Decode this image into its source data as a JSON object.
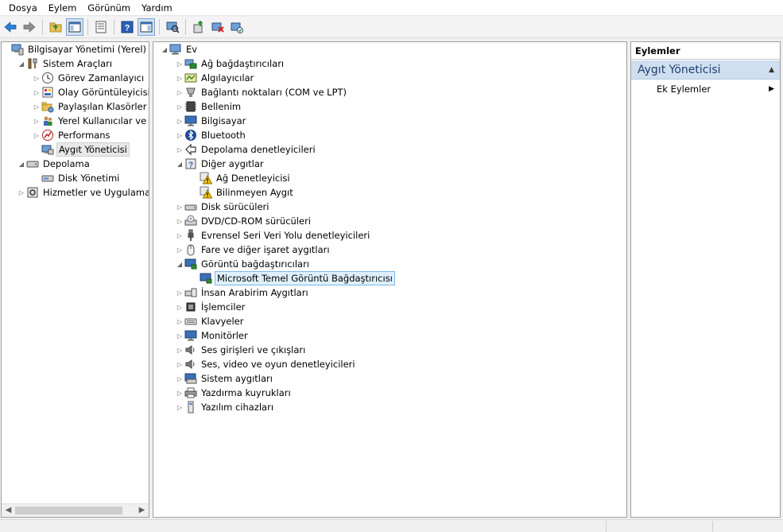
{
  "menu": [
    "Dosya",
    "Eylem",
    "Görünüm",
    "Yardım"
  ],
  "left_tree": [
    {
      "label": "Bilgisayar Yönetimi (Yerel)",
      "level": 0,
      "expander": "",
      "icon": "computer-management-icon"
    },
    {
      "label": "Sistem Araçları",
      "level": 1,
      "expander": "open",
      "icon": "tools-icon"
    },
    {
      "label": "Görev Zamanlayıcı",
      "level": 2,
      "expander": "closed",
      "icon": "clock-icon"
    },
    {
      "label": "Olay Görüntüleyicisi",
      "level": 2,
      "expander": "closed",
      "icon": "event-viewer-icon"
    },
    {
      "label": "Paylaşılan Klasörler",
      "level": 2,
      "expander": "closed",
      "icon": "shared-folder-icon"
    },
    {
      "label": "Yerel Kullanıcılar ve Gru",
      "level": 2,
      "expander": "closed",
      "icon": "users-icon"
    },
    {
      "label": "Performans",
      "level": 2,
      "expander": "closed",
      "icon": "performance-icon"
    },
    {
      "label": "Aygıt Yöneticisi",
      "level": 2,
      "expander": "",
      "icon": "device-manager-icon",
      "selected": true
    },
    {
      "label": "Depolama",
      "level": 1,
      "expander": "open",
      "icon": "storage-icon"
    },
    {
      "label": "Disk Yönetimi",
      "level": 2,
      "expander": "",
      "icon": "disk-management-icon"
    },
    {
      "label": "Hizmetler ve Uygulamalar",
      "level": 1,
      "expander": "closed",
      "icon": "services-icon"
    }
  ],
  "device_tree": [
    {
      "label": "Ev",
      "level": 0,
      "expander": "open",
      "icon": "computer-icon"
    },
    {
      "label": "Ağ bağdaştırıcıları",
      "level": 1,
      "expander": "closed",
      "icon": "network-adapter-icon"
    },
    {
      "label": "Algılayıcılar",
      "level": 1,
      "expander": "closed",
      "icon": "sensor-icon"
    },
    {
      "label": "Bağlantı noktaları (COM ve LPT)",
      "level": 1,
      "expander": "closed",
      "icon": "port-icon"
    },
    {
      "label": "Bellenim",
      "level": 1,
      "expander": "closed",
      "icon": "firmware-icon"
    },
    {
      "label": "Bilgisayar",
      "level": 1,
      "expander": "closed",
      "icon": "monitor-icon"
    },
    {
      "label": "Bluetooth",
      "level": 1,
      "expander": "closed",
      "icon": "bluetooth-icon"
    },
    {
      "label": "Depolama denetleyicileri",
      "level": 1,
      "expander": "closed",
      "icon": "storage-controller-icon"
    },
    {
      "label": "Diğer aygıtlar",
      "level": 1,
      "expander": "open",
      "icon": "other-devices-icon"
    },
    {
      "label": "Ağ Denetleyicisi",
      "level": 2,
      "expander": "",
      "icon": "warning-device-icon"
    },
    {
      "label": "Bilinmeyen Aygıt",
      "level": 2,
      "expander": "",
      "icon": "warning-device-icon"
    },
    {
      "label": "Disk sürücüleri",
      "level": 1,
      "expander": "closed",
      "icon": "disk-drive-icon"
    },
    {
      "label": "DVD/CD-ROM sürücüleri",
      "level": 1,
      "expander": "closed",
      "icon": "dvd-icon"
    },
    {
      "label": "Evrensel Seri Veri Yolu denetleyicileri",
      "level": 1,
      "expander": "closed",
      "icon": "usb-icon"
    },
    {
      "label": "Fare ve diğer işaret aygıtları",
      "level": 1,
      "expander": "closed",
      "icon": "mouse-icon"
    },
    {
      "label": "Görüntü bağdaştırıcıları",
      "level": 1,
      "expander": "open",
      "icon": "display-adapter-icon"
    },
    {
      "label": "Microsoft Temel Görüntü Bağdaştırıcısı",
      "level": 2,
      "expander": "",
      "icon": "display-adapter-icon",
      "selected": true
    },
    {
      "label": "İnsan Arabirim Aygıtları",
      "level": 1,
      "expander": "closed",
      "icon": "hid-icon"
    },
    {
      "label": "İşlemciler",
      "level": 1,
      "expander": "closed",
      "icon": "processor-icon"
    },
    {
      "label": "Klavyeler",
      "level": 1,
      "expander": "closed",
      "icon": "keyboard-icon"
    },
    {
      "label": "Monitörler",
      "level": 1,
      "expander": "closed",
      "icon": "monitor-icon"
    },
    {
      "label": "Ses girişleri ve çıkışları",
      "level": 1,
      "expander": "closed",
      "icon": "speaker-icon"
    },
    {
      "label": "Ses, video ve oyun denetleyicileri",
      "level": 1,
      "expander": "closed",
      "icon": "speaker-icon"
    },
    {
      "label": "Sistem aygıtları",
      "level": 1,
      "expander": "closed",
      "icon": "system-devices-icon"
    },
    {
      "label": "Yazdırma kuyrukları",
      "level": 1,
      "expander": "closed",
      "icon": "printer-icon"
    },
    {
      "label": "Yazılım cihazları",
      "level": 1,
      "expander": "closed",
      "icon": "software-device-icon"
    }
  ],
  "actions": {
    "header": "Eylemler",
    "section": "Aygıt Yöneticisi",
    "item": "Ek Eylemler"
  },
  "colors": {
    "selection_blue": "#dff0fc",
    "selection_border": "#7fb8e6",
    "actions_section_bg": "#cfdff0",
    "warning_yellow": "#f5c400"
  }
}
